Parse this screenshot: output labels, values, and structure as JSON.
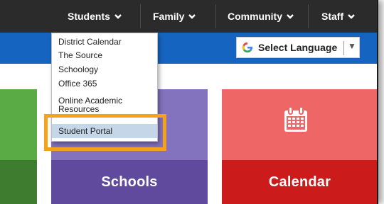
{
  "nav": {
    "items": [
      {
        "label": "Students"
      },
      {
        "label": "Family"
      },
      {
        "label": "Community"
      },
      {
        "label": "Staff"
      }
    ]
  },
  "language": {
    "label": "Select Language",
    "arrow": "▼"
  },
  "dropdown": {
    "items": [
      {
        "label": "District Calendar"
      },
      {
        "label": "The Source"
      },
      {
        "label": "Schoology"
      },
      {
        "label": "Office 365"
      },
      {
        "label_line1": "Online Academic",
        "label_line2": "Resources"
      },
      {
        "label": "Student Portal",
        "state": "hovered"
      }
    ]
  },
  "tiles": {
    "schools": {
      "label": "Schools"
    },
    "calendar": {
      "label": "Calendar"
    }
  },
  "colors": {
    "nav_bg": "#2b2b2b",
    "blue_bar": "#1565c0",
    "green": "#5aaa46",
    "purple": "#8372bd",
    "purple_dark": "#5f4a9e",
    "red": "#ee6666",
    "red_dark": "#cc1b1b",
    "highlight": "#f5a21b"
  },
  "icons": [
    "chevron-down-icon",
    "google-g-icon",
    "calendar-icon"
  ]
}
